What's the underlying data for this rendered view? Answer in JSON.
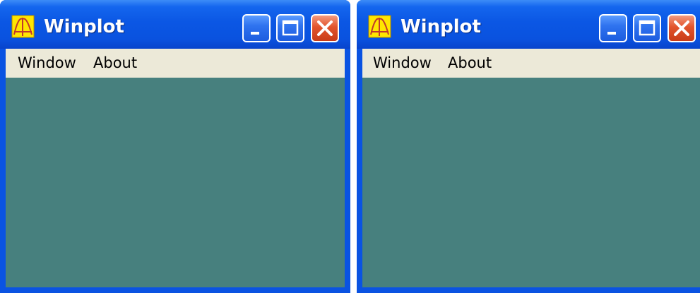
{
  "windows": [
    {
      "title": "Winplot",
      "menu": [
        "Window",
        "About"
      ],
      "buttons": [
        "minimize-icon",
        "maximize-icon",
        "close-icon"
      ]
    },
    {
      "title": "Winplot",
      "menu": [
        "Window",
        "About"
      ],
      "buttons": [
        "minimize-icon",
        "maximize-icon",
        "close-icon"
      ]
    }
  ],
  "colors": {
    "titlebar": "#0b57e4",
    "menubar": "#ece9d8",
    "client": "#47807e",
    "close_button": "#e2542c"
  }
}
